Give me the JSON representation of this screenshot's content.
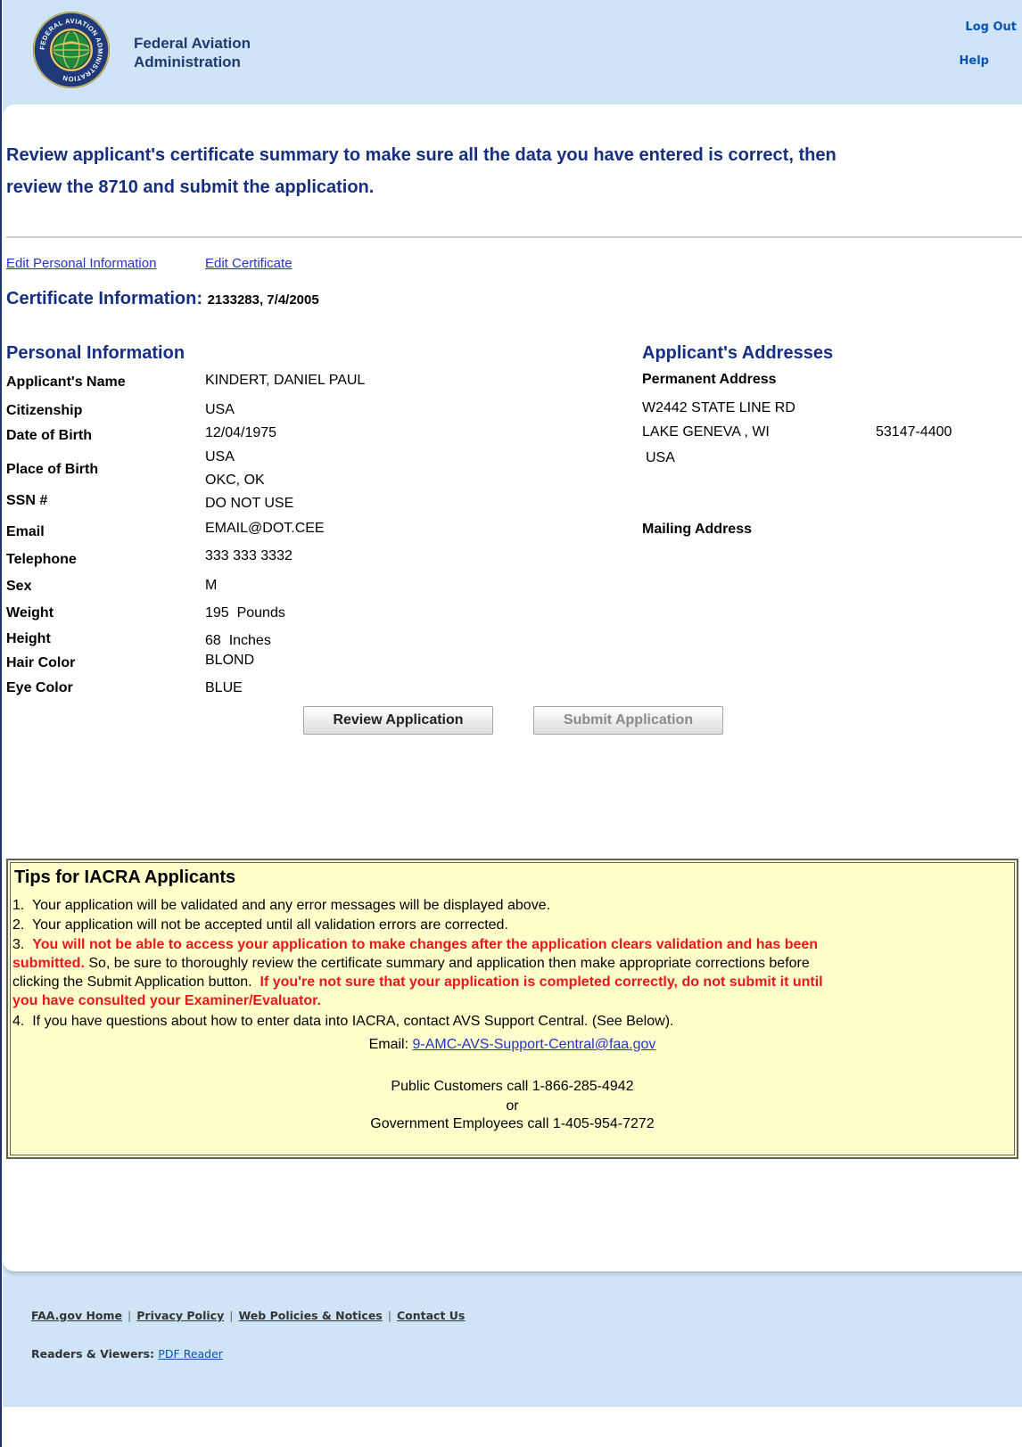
{
  "header": {
    "agency_line1": "Federal Aviation",
    "agency_line2": "Administration",
    "seal_text": "FEDERAL AVIATION ADMINISTRATION",
    "logout": "Log Out",
    "help": "Help"
  },
  "intro": {
    "line1": "Review applicant's certificate summary to make sure all the data you have entered is correct, then",
    "line2": "review the 8710 and submit the application."
  },
  "edit_links": {
    "personal": "Edit Personal Information",
    "certificate": "Edit Certificate"
  },
  "certificate": {
    "label": "Certificate Information: ",
    "value": "2133283, 7/4/2005"
  },
  "personal": {
    "heading": "Personal Information",
    "fields": [
      {
        "label": "Applicant's Name",
        "value": "KINDERT, DANIEL PAUL"
      },
      {
        "label": "Citizenship",
        "value": "USA"
      },
      {
        "label": "Date of Birth",
        "value": "12/04/1975"
      },
      {
        "label": "Place of Birth",
        "value": "USA",
        "value2": "OKC, OK"
      },
      {
        "label": "SSN #",
        "value": "DO NOT USE"
      },
      {
        "label": "Email",
        "value": "EMAIL@DOT.CEE"
      },
      {
        "label": "Telephone",
        "value": "333 333 3332"
      },
      {
        "label": "Sex",
        "value": "M"
      },
      {
        "label": "Weight",
        "value": "195  Pounds"
      },
      {
        "label": "Height",
        "value": "68  Inches"
      },
      {
        "label": "Hair Color",
        "value": "BLOND"
      },
      {
        "label": "Eye Color",
        "value": "BLUE"
      }
    ]
  },
  "addresses": {
    "heading": "Applicant's Addresses",
    "permanent_label": "Permanent Address",
    "street": "W2442 STATE LINE RD",
    "city_state": "LAKE GENEVA , WI",
    "zip": "53147-4400",
    "country": "USA",
    "mailing_label": "Mailing Address"
  },
  "buttons": {
    "review": "Review Application",
    "submit": "Submit Application"
  },
  "tips": {
    "title": "Tips for IACRA Applicants",
    "item1": "1.  Your application will be validated and any error messages will be displayed above.",
    "item2": "2.  Your application will not be accepted until all validation errors are corrected.",
    "item3_num": "3.  ",
    "item3_red1": "You will not be able to access your application to make changes after the application clears validation and has been",
    "item3_red2": "submitted.",
    "item3_text1": " So, be sure to thoroughly review the certificate summary and application then make appropriate corrections before",
    "item3_text2": "clicking the Submit Application button.  ",
    "item3_red3": "If you're not sure that your application is completed correctly, do not submit it until",
    "item3_red4": "you have consulted your Examiner/Evaluator.",
    "item4": "4.  If you have questions about how to enter data into IACRA, contact AVS Support Central. (See Below).",
    "email_label": "Email: ",
    "email": "9-AMC-AVS-Support-Central@faa.gov",
    "public_call": "Public Customers call 1-866-285-4942",
    "or": "or",
    "gov_call": "Government Employees call 1-405-954-7272"
  },
  "footer": {
    "links": [
      "FAA.gov Home",
      "Privacy Policy",
      "Web Policies & Notices",
      "Contact Us"
    ],
    "separator": "|",
    "readers_label": "Readers & Viewers: ",
    "pdf_reader": "PDF Reader"
  },
  "colors": {
    "page_bg": "#cfe5f7",
    "heading_navy": "#172f82",
    "warning_red": "#e8171a",
    "tips_bg": "#ffffcc",
    "link_blue": "#2733c9"
  }
}
